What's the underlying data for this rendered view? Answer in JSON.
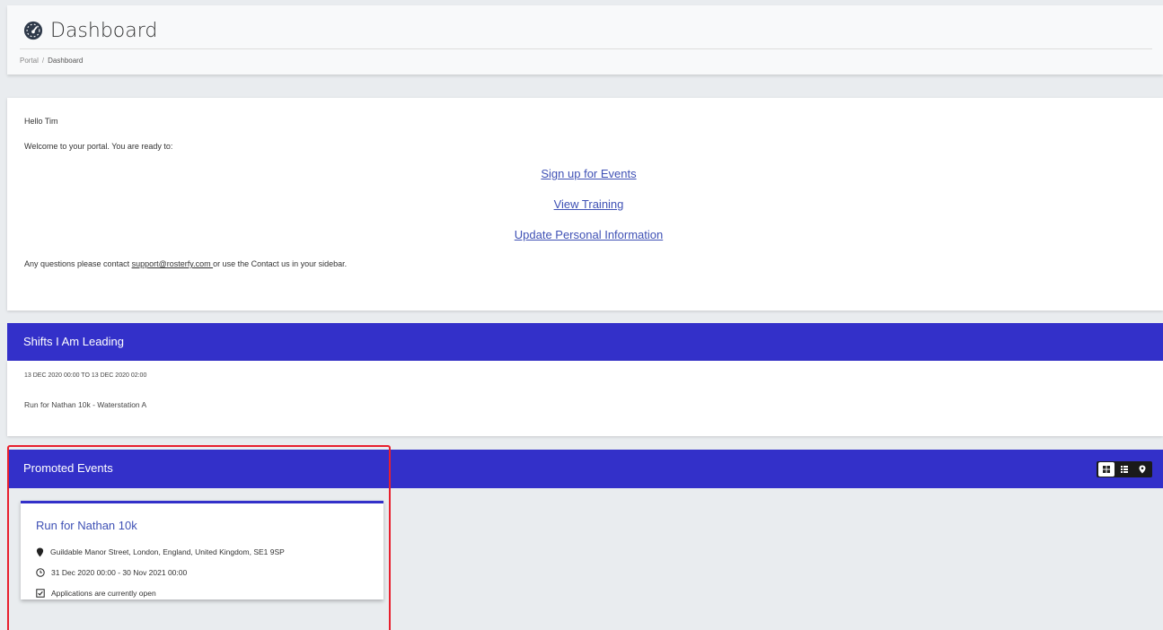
{
  "header": {
    "title": "Dashboard",
    "title_icon": "tachometer-icon",
    "breadcrumb": {
      "portal": "Portal",
      "separator": "/",
      "current": "Dashboard"
    }
  },
  "welcome": {
    "greeting": "Hello Tim",
    "intro": "Welcome to your portal. You are ready to:",
    "links": [
      "Sign up for Events",
      "View Training",
      "Update Personal Information"
    ],
    "questions_prefix": "Any questions please contact ",
    "support_email": "support@rosterfy.com ",
    "questions_suffix": "or use the Contact us in your sidebar."
  },
  "shifts": {
    "title": "Shifts I Am Leading",
    "items": [
      {
        "datetime": "13 DEC 2020 00:00 TO 13 DEC 2020 02:00",
        "name": "Run for Nathan 10k - Waterstation A"
      }
    ]
  },
  "promoted_events": {
    "title": "Promoted Events",
    "view_icons": [
      "grid-view-icon",
      "list-view-icon",
      "map-pin-icon"
    ],
    "events": [
      {
        "title": "Run for Nathan 10k",
        "location": "Guildable Manor Street, London, England, United Kingdom, SE1 9SP",
        "dates": "31 Dec 2020 00:00 - 30 Nov 2021 00:00",
        "status": "Applications are currently open"
      }
    ]
  },
  "colors": {
    "section_bar": "#3330c9",
    "link": "#3f51b5",
    "highlight_outline": "#e8202e",
    "page_bg": "#e9ecef"
  }
}
